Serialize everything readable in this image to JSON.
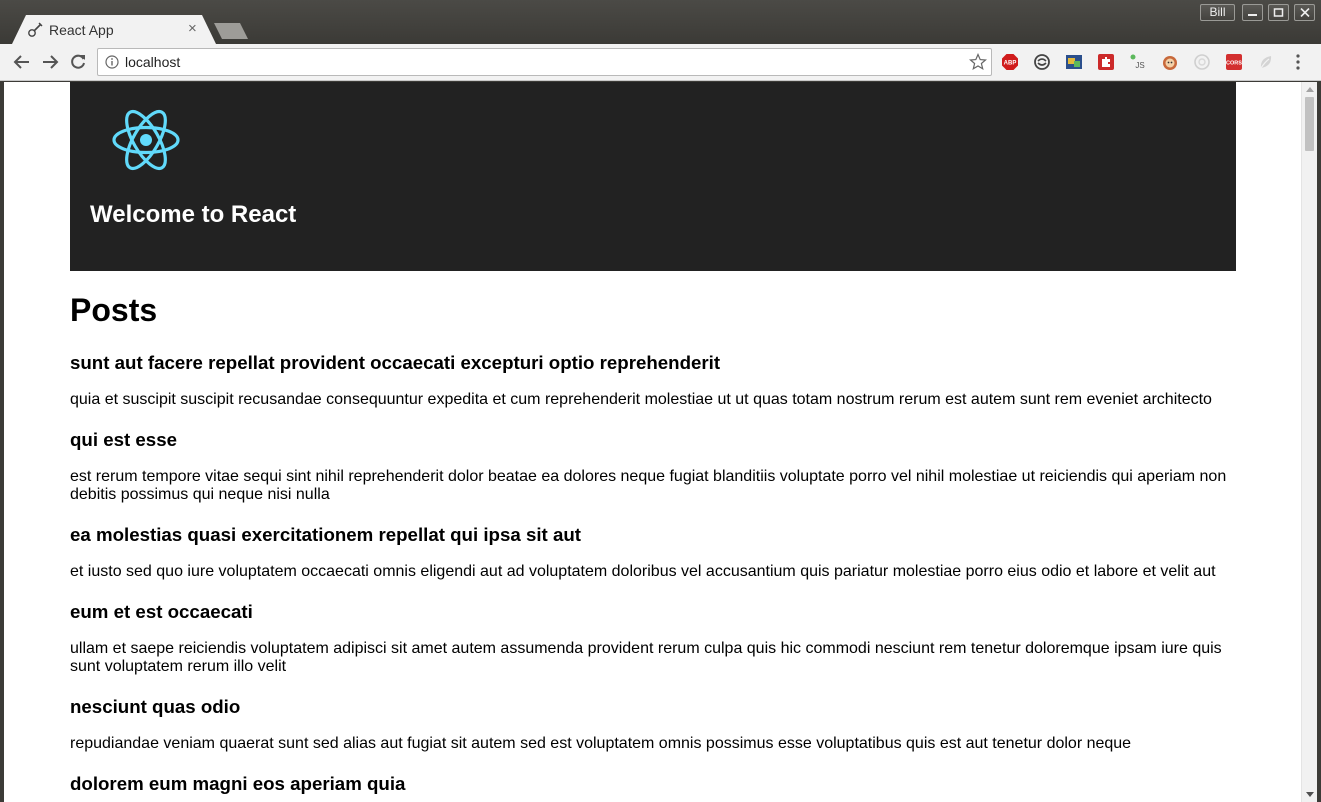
{
  "browser": {
    "tab_title": "React App",
    "tab_close": "×",
    "profile_name": "Bill",
    "url": "localhost",
    "extensions": [
      "abp-icon",
      "sync-icon",
      "window-resizer-icon",
      "puzzle-icon",
      "js-icon",
      "octocat-icon",
      "circle-ext-icon",
      "cors-icon",
      "leaf-ext-icon"
    ],
    "extension_labels": {
      "abp": "ABP",
      "cors": "CORS",
      "js": "JS"
    }
  },
  "page": {
    "header_title": "Welcome to React",
    "posts_heading": "Posts",
    "posts": [
      {
        "title": "sunt aut facere repellat provident occaecati excepturi optio reprehenderit",
        "body": "quia et suscipit suscipit recusandae consequuntur expedita et cum reprehenderit molestiae ut ut quas totam nostrum rerum est autem sunt rem eveniet architecto"
      },
      {
        "title": "qui est esse",
        "body": "est rerum tempore vitae sequi sint nihil reprehenderit dolor beatae ea dolores neque fugiat blanditiis voluptate porro vel nihil molestiae ut reiciendis qui aperiam non debitis possimus qui neque nisi nulla"
      },
      {
        "title": "ea molestias quasi exercitationem repellat qui ipsa sit aut",
        "body": "et iusto sed quo iure voluptatem occaecati omnis eligendi aut ad voluptatem doloribus vel accusantium quis pariatur molestiae porro eius odio et labore et velit aut"
      },
      {
        "title": "eum et est occaecati",
        "body": "ullam et saepe reiciendis voluptatem adipisci sit amet autem assumenda provident rerum culpa quis hic commodi nesciunt rem tenetur doloremque ipsam iure quis sunt voluptatem rerum illo velit"
      },
      {
        "title": "nesciunt quas odio",
        "body": "repudiandae veniam quaerat sunt sed alias aut fugiat sit autem sed est voluptatem omnis possimus esse voluptatibus quis est aut tenetur dolor neque"
      },
      {
        "title": "dolorem eum magni eos aperiam quia",
        "body": ""
      }
    ]
  },
  "colors": {
    "header_bg": "#222222",
    "react_blue": "#61dafb",
    "chrome_frame": "#3c3b37"
  }
}
